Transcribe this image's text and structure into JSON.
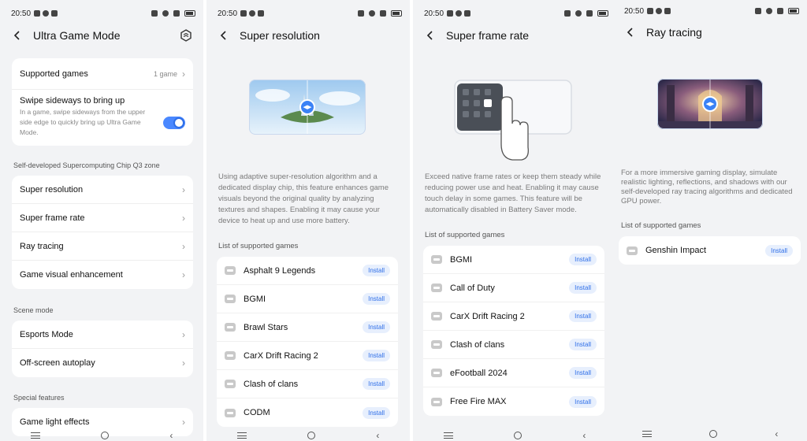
{
  "status": {
    "time": "20:50"
  },
  "panel1": {
    "title": "Ultra Game Mode",
    "supported_games": {
      "label": "Supported games",
      "value": "1 game"
    },
    "swipe": {
      "title": "Swipe sideways to bring up",
      "desc": "In a game, swipe sideways from the upper side edge to quickly bring up Ultra Game Mode.",
      "enabled": true
    },
    "section_chip": "Self-developed Supercomputing Chip Q3 zone",
    "chip_items": [
      "Super resolution",
      "Super frame rate",
      "Ray tracing",
      "Game visual enhancement"
    ],
    "section_scene": "Scene mode",
    "scene_items": [
      "Esports Mode",
      "Off-screen autoplay"
    ],
    "section_special": "Special features",
    "special_items": [
      "Game light effects"
    ]
  },
  "panel2": {
    "title": "Super resolution",
    "desc": "Using adaptive super-resolution algorithm and a dedicated display chip, this feature enhances game visuals beyond the original quality by analyzing textures and shapes. Enabling it may cause your device to heat up and use more battery.",
    "list_title": "List of supported games",
    "games": [
      "Asphalt 9 Legends",
      "BGMI",
      "Brawl Stars",
      "CarX Drift Racing 2",
      "Clash of clans",
      "CODM"
    ],
    "install_label": "Install"
  },
  "panel3": {
    "title": "Super frame rate",
    "desc": "Exceed native frame rates or keep them steady while reducing power use and heat. Enabling it may cause touch delay in some games. This feature will be automatically disabled in Battery Saver mode.",
    "list_title": "List of supported games",
    "games": [
      "BGMI",
      "Call of Duty",
      "CarX Drift Racing 2",
      "Clash of clans",
      "eFootball 2024",
      "Free Fire MAX"
    ],
    "install_label": "Install"
  },
  "panel4": {
    "title": "Ray tracing",
    "desc": "For a more immersive gaming display, simulate realistic lighting, reflections, and shadows with our self-developed ray tracing algorithms and dedicated GPU power.",
    "list_title": "List of supported games",
    "games": [
      "Genshin Impact"
    ],
    "install_label": "Install"
  },
  "colors": {
    "accent": "#2f6fe8",
    "background": "#f2f3f5",
    "card": "#ffffff"
  }
}
